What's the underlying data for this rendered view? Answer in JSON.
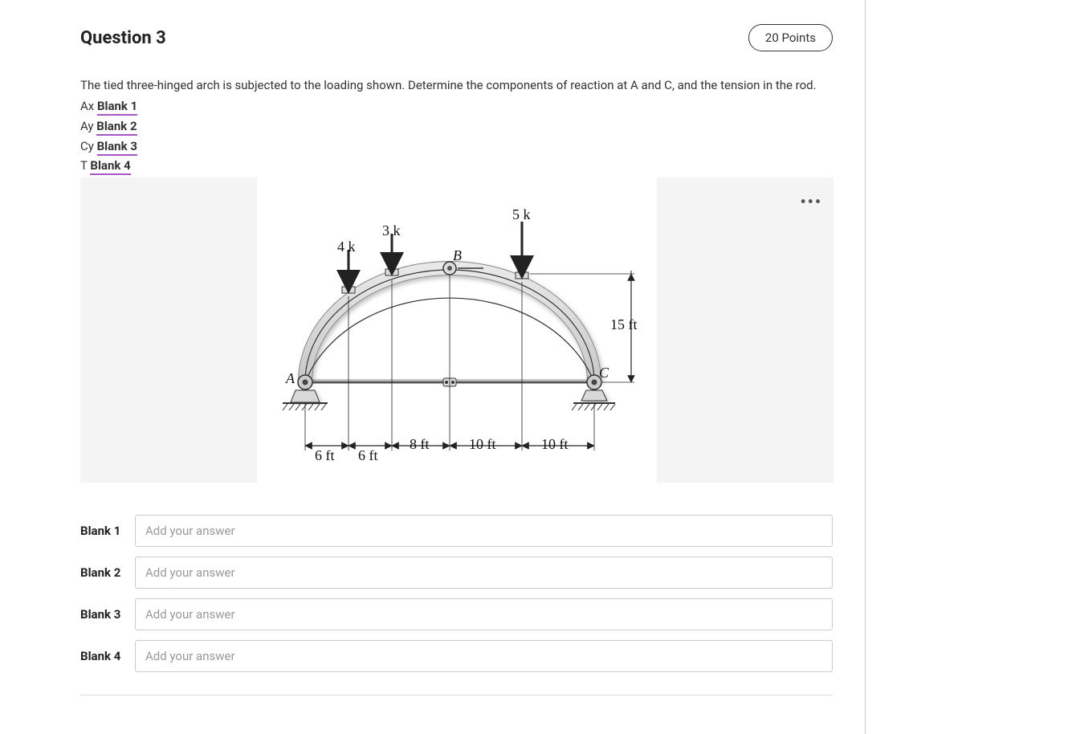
{
  "header": {
    "title": "Question 3",
    "points": "20 Points"
  },
  "prompt": "The tied three-hinged arch is subjected to the loading shown. Determine the components of reaction at A and C, and the tension in the rod.",
  "variables": {
    "ax_prefix": "Ax ",
    "ax_blank": "Blank 1",
    "ay_prefix": "Ay ",
    "ay_blank": "Blank 2",
    "cy_prefix": "Cy ",
    "cy_blank": "Blank 3",
    "t_prefix": "T ",
    "t_blank": "Blank 4"
  },
  "figure": {
    "loads": {
      "l1": "4 k",
      "l2": "3 k",
      "l3": "5 k"
    },
    "points": {
      "A": "A",
      "B": "B",
      "C": "C"
    },
    "dims": {
      "d1": "6 ft",
      "d2": "6 ft",
      "d3": "8 ft",
      "d4": "10 ft",
      "d5": "10 ft",
      "h": "15 ft"
    },
    "more": "•••"
  },
  "answers": [
    {
      "label": "Blank 1",
      "placeholder": "Add your answer"
    },
    {
      "label": "Blank 2",
      "placeholder": "Add your answer"
    },
    {
      "label": "Blank 3",
      "placeholder": "Add your answer"
    },
    {
      "label": "Blank 4",
      "placeholder": "Add your answer"
    }
  ]
}
